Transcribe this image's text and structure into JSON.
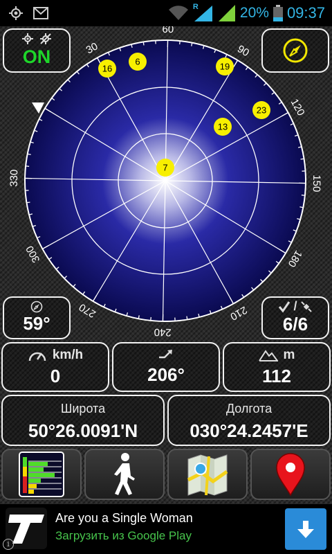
{
  "status_bar": {
    "icons": [
      "gps-icon",
      "gmail-icon",
      "wifi-icon",
      "signal-icon",
      "battery-icon"
    ],
    "roaming": "R",
    "battery": "20%",
    "time": "09:37",
    "accent_color": "#33b5e5"
  },
  "gps_toggle": {
    "state": "ON",
    "icons": [
      "satellite-icon",
      "satellite-off-icon"
    ],
    "color": "#1ed62a"
  },
  "compass_button": {
    "icon": "compass-icon",
    "color": "#f2e700"
  },
  "radar": {
    "degree_labels": [
      "60",
      "90",
      "120",
      "150",
      "180",
      "210",
      "240",
      "270",
      "300",
      "330",
      "30"
    ],
    "satellites": [
      "16",
      "6",
      "19",
      "23",
      "13",
      "7"
    ]
  },
  "heading": {
    "icon": "compass-needle-icon",
    "value": "59°"
  },
  "satellites_count": {
    "icons": [
      "checkmark-icon",
      "satellite-icon"
    ],
    "separator": "/",
    "value": "6/6"
  },
  "speed": {
    "icon": "speedometer-icon",
    "unit": "km/h",
    "value": "0"
  },
  "course": {
    "icon": "direction-icon",
    "value": "206°"
  },
  "altitude": {
    "icon": "mountain-icon",
    "unit": "m",
    "value": "112"
  },
  "latitude": {
    "label": "Широта",
    "value": "50°26.0091'N"
  },
  "longitude": {
    "label": "Долгота",
    "value": "030°24.2457'E"
  },
  "toolbar": {
    "buttons": [
      "signal-bars-button",
      "walk-button",
      "map-button",
      "location-pin-button"
    ]
  },
  "ad": {
    "title": "Are you a Single Woman",
    "subtitle": "Загрузить из Google Play",
    "logo_icon": "t-logo-icon",
    "download_icon": "download-arrow-icon",
    "info_icon": "info-icon"
  }
}
